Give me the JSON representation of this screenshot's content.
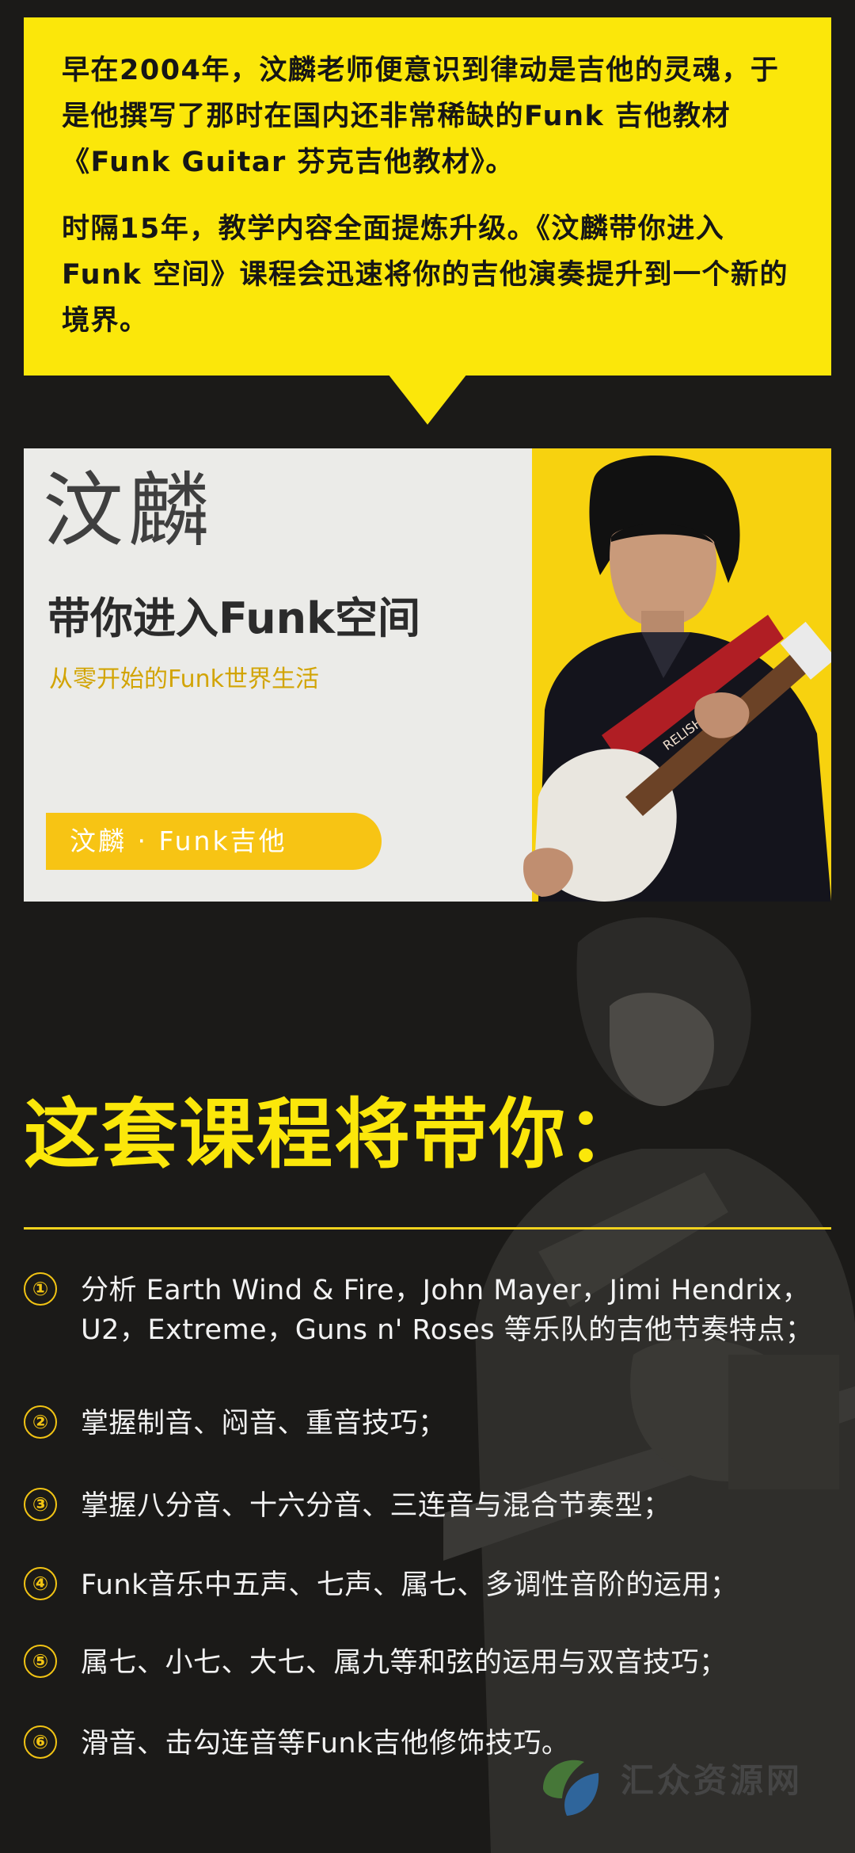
{
  "intro": {
    "paragraph1": "早在2004年，汶麟老师便意识到律动是吉他的灵魂，于是他撰写了那时在国内还非常稀缺的Funk 吉他教材《Funk Guitar 芬克吉他教材》。",
    "paragraph2": "时隔15年，教学内容全面提炼升级。《汶麟带你进入 Funk 空间》课程会迅速将你的吉他演奏提升到一个新的境界。"
  },
  "banner": {
    "name": "汶麟",
    "subtitle": "带你进入Funk空间",
    "tagline": "从零开始的Funk世界生活",
    "pill": "汶麟 · Funk吉他",
    "strap_text": "RELISH"
  },
  "course": {
    "title": "这套课程将带你：",
    "items": [
      {
        "num": "①",
        "text": "分析 Earth Wind & Fire，John Mayer，Jimi Hendrix，U2，Extreme，Guns n' Roses 等乐队的吉他节奏特点；"
      },
      {
        "num": "②",
        "text": "掌握制音、闷音、重音技巧；"
      },
      {
        "num": "③",
        "text": "掌握八分音、十六分音、三连音与混合节奏型；"
      },
      {
        "num": "④",
        "text": "Funk音乐中五声、七声、属七、多调性音阶的运用；"
      },
      {
        "num": "⑤",
        "text": "属七、小七、大七、属九等和弦的运用与双音技巧；"
      },
      {
        "num": "⑥",
        "text": "滑音、击勾连音等Funk吉他修饰技巧。"
      }
    ]
  },
  "watermark": {
    "text": "汇众资源网"
  },
  "colors": {
    "accent_yellow": "#fbe70a",
    "background": "#1b1a18",
    "banner_bg": "#ebebe8"
  },
  "icons": [
    "leaf-logo-icon",
    "guitar-image",
    "performer-photo"
  ]
}
